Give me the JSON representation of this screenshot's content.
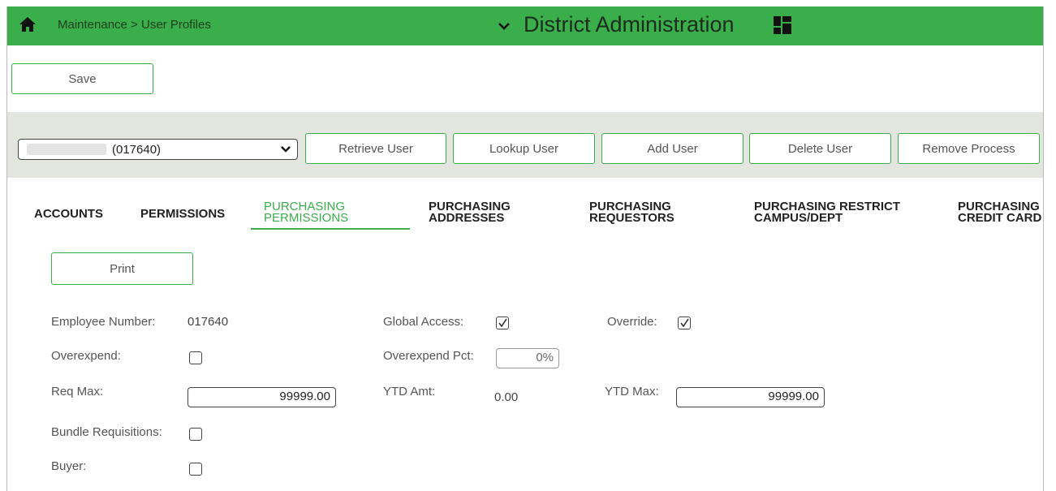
{
  "header": {
    "breadcrumb": "Maintenance > User Profiles",
    "app_title": "District Administration",
    "bar_color": "#3aae4a"
  },
  "toolbar": {
    "save_label": "Save"
  },
  "user_bar": {
    "selected_user": "(017640)",
    "buttons": [
      "Retrieve User",
      "Lookup User",
      "Add User",
      "Delete User",
      "Remove Process"
    ]
  },
  "tabs": [
    {
      "label": "ACCOUNTS",
      "active": false
    },
    {
      "label": "PERMISSIONS",
      "active": false
    },
    {
      "label": "PURCHASING\nPERMISSIONS",
      "active": true
    },
    {
      "label": "PURCHASING\nADDRESSES",
      "active": false
    },
    {
      "label": "PURCHASING\nREQUESTORS",
      "active": false
    },
    {
      "label": "PURCHASING RESTRICT\nCAMPUS/DEPT",
      "active": false
    },
    {
      "label": "PURCHASING\nCREDIT CARD",
      "active": false
    }
  ],
  "form": {
    "print_label": "Print",
    "employee_number_label": "Employee Number:",
    "employee_number": "017640",
    "global_access_label": "Global Access:",
    "global_access": true,
    "override_label": "Override:",
    "override": true,
    "overexpend_label": "Overexpend:",
    "overexpend": false,
    "overexpend_pct_label": "Overexpend Pct:",
    "overexpend_pct": "0%",
    "req_max_label": "Req Max:",
    "req_max": "99999.00",
    "ytd_amt_label": "YTD Amt:",
    "ytd_amt": "0.00",
    "ytd_max_label": "YTD Max:",
    "ytd_max": "99999.00",
    "bundle_label": "Bundle Requisitions:",
    "bundle": false,
    "buyer_label": "Buyer:",
    "buyer": false
  }
}
